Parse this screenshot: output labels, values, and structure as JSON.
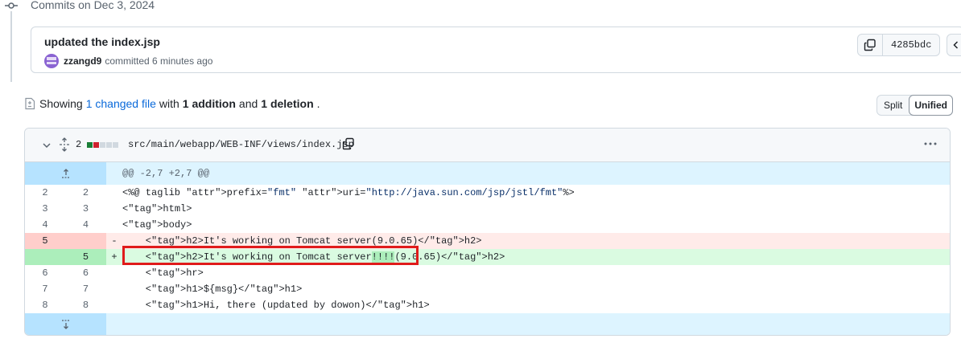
{
  "timeline": {
    "title": "Commits on Dec 3, 2024"
  },
  "commit": {
    "title": "updated the index.jsp",
    "author": "zzangd9",
    "action": "committed",
    "time": "6 minutes ago",
    "sha": "4285bdc"
  },
  "summary": {
    "prefix": "Showing",
    "changed_files": "1 changed file",
    "with": "with",
    "additions": "1 addition",
    "and": "and",
    "deletions": "1 deletion",
    "suffix": "."
  },
  "view_toggle": {
    "split": "Split",
    "unified": "Unified",
    "selected": "Unified"
  },
  "file": {
    "change_count": "2",
    "path": "src/main/webapp/WEB-INF/views/index.jsp",
    "hunk_header": "@@ -2,7 +2,7 @@",
    "lines": [
      {
        "type": "ctx",
        "old": "2",
        "new": "2",
        "sign": "",
        "code": "<%@ taglib prefix=\"fmt\" uri=\"http://java.sun.com/jsp/jstl/fmt\"%>"
      },
      {
        "type": "ctx",
        "old": "3",
        "new": "3",
        "sign": "",
        "code": "<html>"
      },
      {
        "type": "ctx",
        "old": "4",
        "new": "4",
        "sign": "",
        "code": "<body>"
      },
      {
        "type": "del",
        "old": "5",
        "new": "",
        "sign": "-",
        "code": "    <h2>It's working on Tomcat server(9.0.65)</h2>"
      },
      {
        "type": "add",
        "old": "",
        "new": "5",
        "sign": "+",
        "code": "    <h2>It's working on Tomcat server!!!!(9.0.65)</h2>"
      },
      {
        "type": "ctx",
        "old": "6",
        "new": "6",
        "sign": "",
        "code": "    <hr>"
      },
      {
        "type": "ctx",
        "old": "7",
        "new": "7",
        "sign": "",
        "code": "    <h1>${msg}</h1>"
      },
      {
        "type": "ctx",
        "old": "8",
        "new": "8",
        "sign": "",
        "code": "    <h1>Hi, there (updated by dowon)</h1>"
      }
    ]
  },
  "colors": {
    "addition": "#1a7f37",
    "deletion": "#cf222e",
    "link": "#0969da",
    "annotation": "#e01b1b"
  },
  "icons": {
    "timeline": "git-commit-icon",
    "copy": "copy-icon",
    "browse": "code-icon",
    "file_summary": "file-diff-icon",
    "collapse": "chevron-down-icon",
    "expand": "unfold-icon",
    "more": "kebab-horizontal-icon",
    "expand_up": "fold-up-icon",
    "expand_down": "fold-down-icon"
  }
}
